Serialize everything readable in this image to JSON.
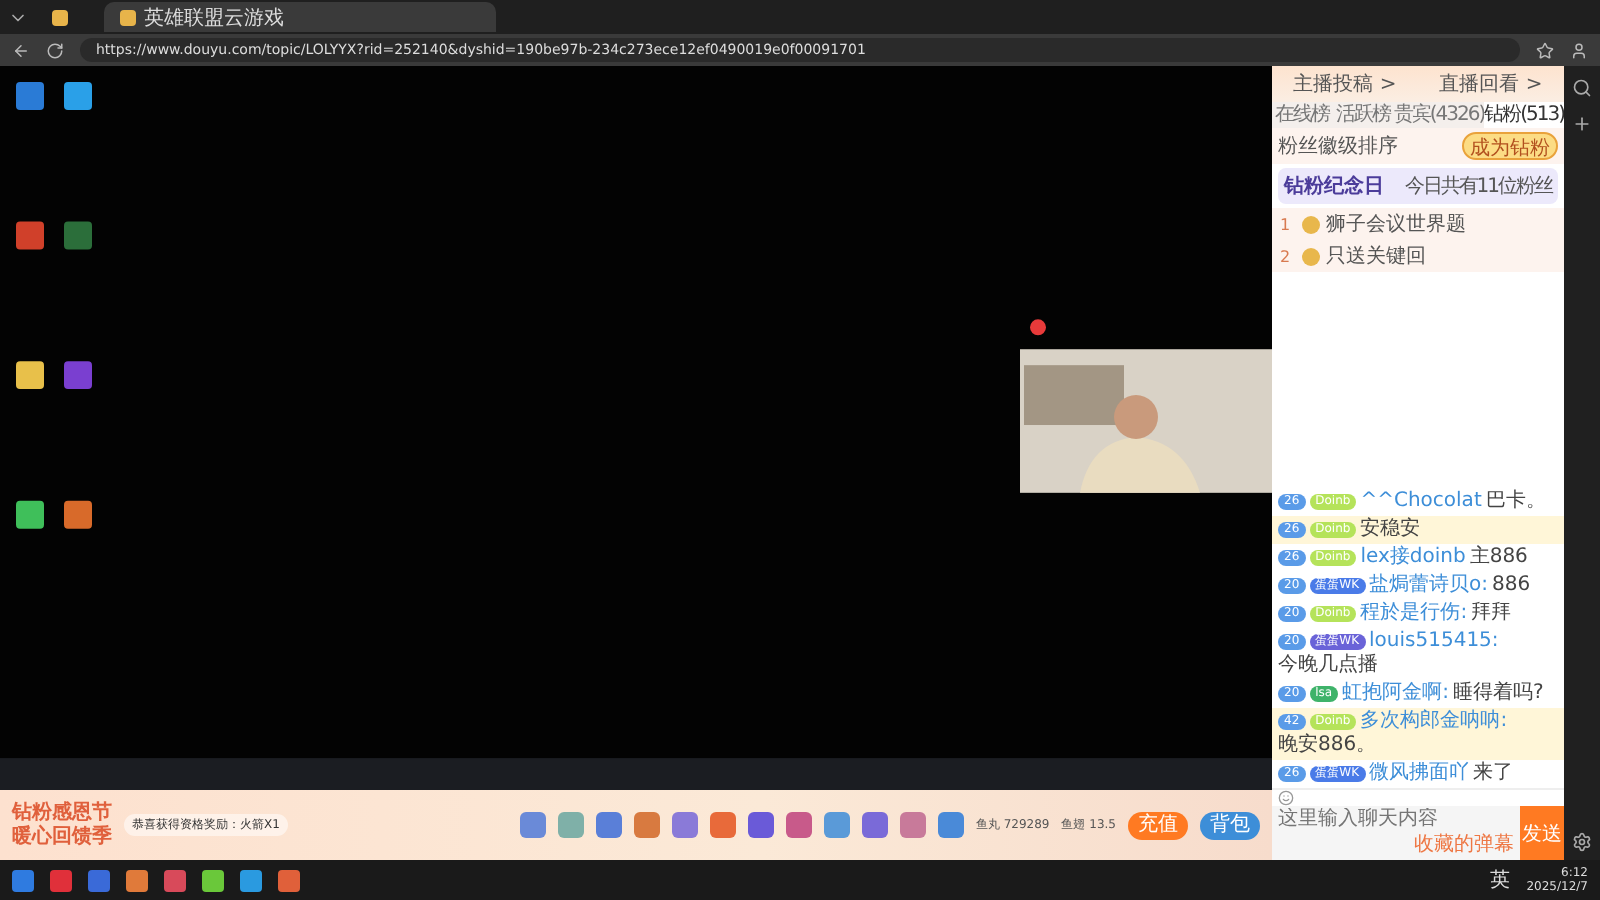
{
  "browser": {
    "tabs": [
      {
        "selected": false
      },
      {
        "title": "英雄联盟云游戏",
        "selected": true
      }
    ],
    "url": "https://www.douyu.com/topic/LOLYYX?rid=252140&dyshid=190be97b-234c273ece12ef0490019e0f00091701"
  },
  "chat": {
    "links": [
      "主播投稿 >",
      "直播回看 >"
    ],
    "tabs": [
      {
        "label": "在线榜",
        "selected": false
      },
      {
        "label": "活跃榜",
        "selected": false
      },
      {
        "label": "贵宾(4326)",
        "selected": false
      },
      {
        "label": "钻粉(513)",
        "selected": true
      }
    ],
    "sort_label": "粉丝徽级排序",
    "join_button": "成为钻粉",
    "anniversary": {
      "title": "钻粉纪念日",
      "note": "今日共有11位粉丝"
    },
    "ranks": [
      {
        "rank": "1",
        "name": "狮子会议世界题"
      },
      {
        "rank": "2",
        "name": "只送关键回"
      }
    ],
    "messages": [
      {
        "level": "26",
        "medal": "Doinb",
        "color": "#b5e35a",
        "user": "^^Chocolat",
        "text": "巴卡。",
        "highlighted": false
      },
      {
        "level": "26",
        "medal": "Doinb",
        "color": "#b5e35a",
        "text": "安稳安",
        "highlighted": true
      },
      {
        "level": "26",
        "medal": "Doinb",
        "color": "#b5e35a",
        "user": "lex接doinb",
        "text": "主886",
        "highlighted": false
      },
      {
        "level": "20",
        "medal": "蛋蛋WK",
        "color": "#4a7be8",
        "user": "盐焗蕾诗贝o:",
        "text": "886",
        "highlighted": false
      },
      {
        "level": "20",
        "medal": "Doinb",
        "color": "#b5e35a",
        "user": "程於是行伤:",
        "text": "拜拜",
        "highlighted": false
      },
      {
        "level": "20",
        "medal": "蛋蛋WK",
        "color": "#6a63d8",
        "user": "louis515415:",
        "text": "今晚几点播",
        "highlighted": false
      },
      {
        "level": "20",
        "medal": "lsa",
        "color": "#3fb36a",
        "user": "虹抱阿金啊:",
        "text": "睡得着吗?",
        "highlighted": false
      },
      {
        "level": "42",
        "medal": "Doinb",
        "color": "#b5e35a",
        "user": "多次构郎金呐呐:",
        "text": "晚安886。",
        "highlighted": true
      },
      {
        "level": "26",
        "medal": "蛋蛋WK",
        "color": "#4a7be8",
        "user": "微风拂面吖",
        "text": "来了",
        "highlighted": false
      }
    ],
    "input": {
      "placeholder": "这里输入聊天内容",
      "favorites": "收藏的弹幕",
      "send": "发送"
    }
  },
  "gift_bar": {
    "promo_title": "钻粉感恩节",
    "promo_subtitle": "暖心回馈季",
    "notice": "恭喜获得资格奖励：火箭X1",
    "fish_ball": "鱼丸 729289",
    "fish_fin": "鱼翅 13.5",
    "recharge": "充值",
    "backpack": "背包"
  },
  "taskbar": {
    "language": "英",
    "time": "6:12",
    "date": "2025/12/7"
  }
}
